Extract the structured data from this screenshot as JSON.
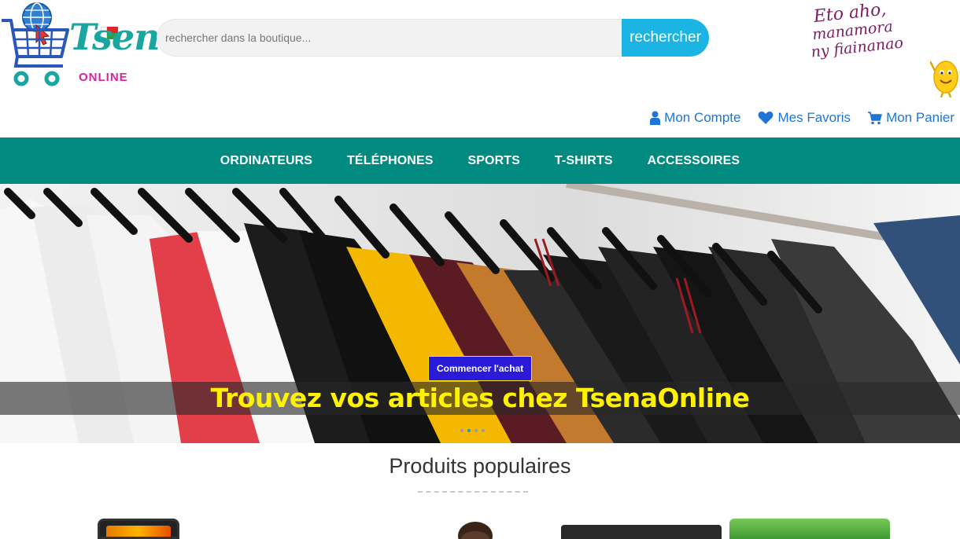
{
  "header": {
    "logo": {
      "wordmark": "Tsena",
      "sub": "ONLINE"
    },
    "search": {
      "placeholder": "rechercher dans la boutique...",
      "button_label": "rechercher"
    },
    "slogan": [
      "Eto aho,",
      "manamora",
      "ny fiainanao"
    ],
    "account": {
      "account_label": "Mon Compte",
      "favorites_label": "Mes Favoris",
      "cart_label": "Mon Panier"
    }
  },
  "nav": {
    "items": [
      "ORDINATEURS",
      "TÉLÉPHONES",
      "SPORTS",
      "T-SHIRTS",
      "ACCESSOIRES"
    ]
  },
  "hero": {
    "cta_label": "Commencer l'achat",
    "caption": "Trouvez vos articles chez TsenaOnline",
    "slide_count": 4,
    "active_slide": 2
  },
  "popular": {
    "title": "Produits populaires"
  },
  "colors": {
    "nav_bg": "#008a80",
    "search_button": "#1cb4e3",
    "link_blue": "#1f74d6",
    "cta_bg": "#2a1bd8",
    "caption_yellow": "#fff200"
  }
}
